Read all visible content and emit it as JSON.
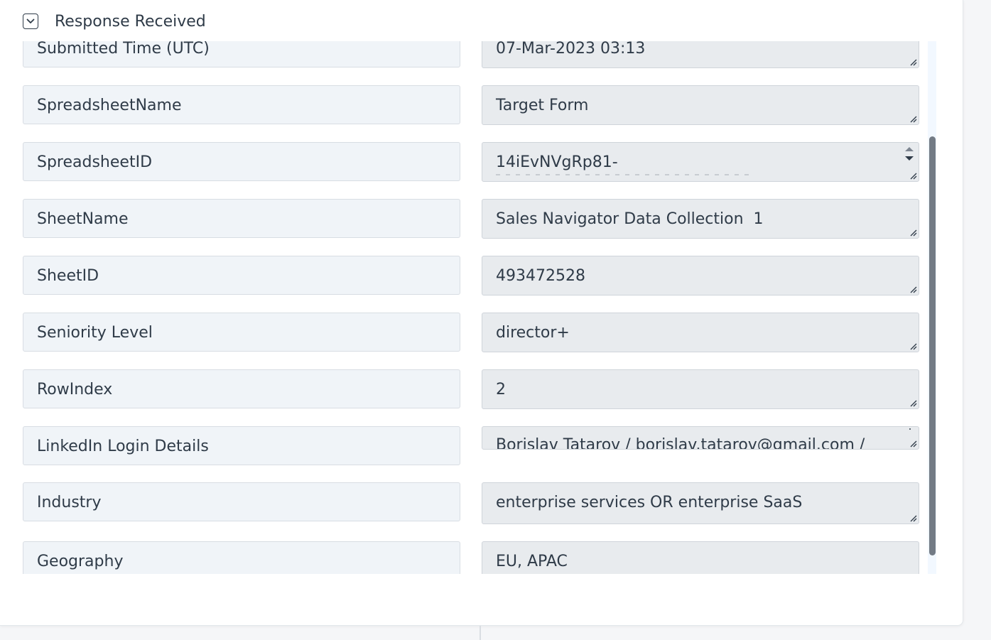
{
  "section": {
    "title": "Response Received"
  },
  "fields": [
    {
      "label": "Submitted Time (UTC)",
      "value": "07-Mar-2023 03:13"
    },
    {
      "label": "SpreadsheetName",
      "value": "Target Form"
    },
    {
      "label": "SpreadsheetID",
      "value": "14iEvNVgRp81-"
    },
    {
      "label": "SheetName",
      "value": "Sales Navigator Data Collection  1"
    },
    {
      "label": "SheetID",
      "value": "493472528"
    },
    {
      "label": "Seniority Level",
      "value": "director+"
    },
    {
      "label": "RowIndex",
      "value": "2"
    },
    {
      "label": "LinkedIn Login Details",
      "value": "Borislav Tatarov / borislav.tatarov@gmail.com /"
    },
    {
      "label": "Industry",
      "value": "enterprise services OR enterprise SaaS"
    },
    {
      "label": "Geography",
      "value": "EU, APAC"
    }
  ],
  "icons": {
    "toggle": "chevron-down-icon",
    "resize": "resize-grip-icon",
    "spinner_up": "arrow-up-icon",
    "spinner_down": "arrow-down-icon"
  },
  "colors": {
    "text": "#2f3b48",
    "label_bg": "#f0f4f8",
    "value_bg": "#e8ebee",
    "scroll_thumb": "#737b85"
  }
}
